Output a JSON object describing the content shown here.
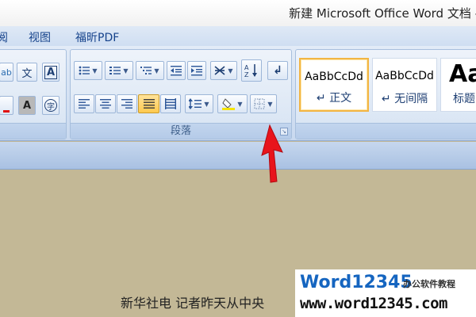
{
  "window": {
    "title": "新建 Microsoft Office Word 文档 -"
  },
  "menu": {
    "items": [
      {
        "label": "阅"
      },
      {
        "label": "视图"
      },
      {
        "label": "福昕PDF"
      }
    ]
  },
  "ribbon": {
    "font_group": {
      "top_icons": [
        "text-effect-icon",
        "phonetic-guide-icon",
        "character-border-icon"
      ],
      "bottom_icons": [
        "font-color-icon",
        "character-shading-icon",
        "enclosed-character-icon"
      ],
      "phonetic_glyph": "文",
      "border_glyph": "A",
      "shading_glyph": "A",
      "enclosed_glyph": "字"
    },
    "paragraph_group": {
      "label": "段落",
      "row1_icons": [
        "bullets-icon",
        "numbering-icon",
        "multilevel-list-icon",
        "decrease-indent-icon",
        "increase-indent-icon",
        "chinese-layout-icon",
        "sort-icon",
        "show-marks-icon"
      ],
      "row2_icons": [
        "align-left-icon",
        "center-icon",
        "align-right-icon",
        "justify-icon",
        "distributed-icon",
        "line-spacing-icon",
        "shading-icon",
        "borders-icon"
      ],
      "active_button": "justify"
    },
    "styles_group": {
      "tiles": [
        {
          "sample": "AaBbCcDd",
          "name": "↵ 正文"
        },
        {
          "sample": "AaBbCcDd",
          "name": "↵ 无间隔"
        },
        {
          "sample": "Aa",
          "name": "标题"
        }
      ]
    }
  },
  "document": {
    "visible_text": "新华社电  记者昨天从中央"
  },
  "watermark": {
    "logo": "Word12345",
    "tagline": "办公软件教程",
    "url": "www.word12345.com"
  },
  "annotation": {
    "arrow_color": "#e8141c",
    "points_to": "paragraph-dialog-launcher"
  }
}
